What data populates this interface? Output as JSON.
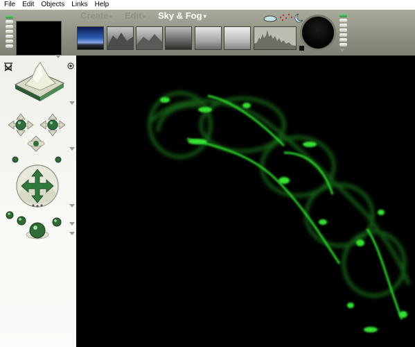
{
  "menu": [
    "File",
    "Edit",
    "Objects",
    "Links",
    "Help"
  ],
  "tabs": [
    {
      "label": "Create",
      "active": false
    },
    {
      "label": "Edit",
      "active": false
    },
    {
      "label": "Sky & Fog",
      "active": true
    }
  ],
  "sky_presets": [
    "sunset-sky-preset-icon",
    "mountain-fog-preset-icon",
    "mountain-haze-preset-icon",
    "gray-fog-preset-icon",
    "gray-sky-preset-icon",
    "pale-sky-preset-icon"
  ],
  "colors": {
    "glow": "#29d22a",
    "chrome": "#9c9e90",
    "panel": "#f4f5ef"
  }
}
